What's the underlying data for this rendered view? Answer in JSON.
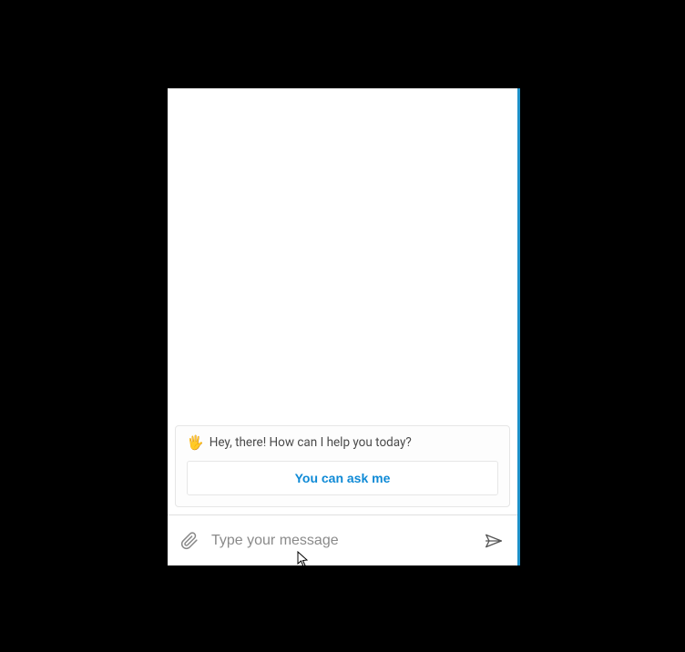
{
  "greeting": {
    "icon": "🖐",
    "text": "Hey, there! How can I help you today?"
  },
  "suggestion": {
    "label": "You can ask me"
  },
  "input": {
    "placeholder": "Type your message",
    "value": ""
  }
}
